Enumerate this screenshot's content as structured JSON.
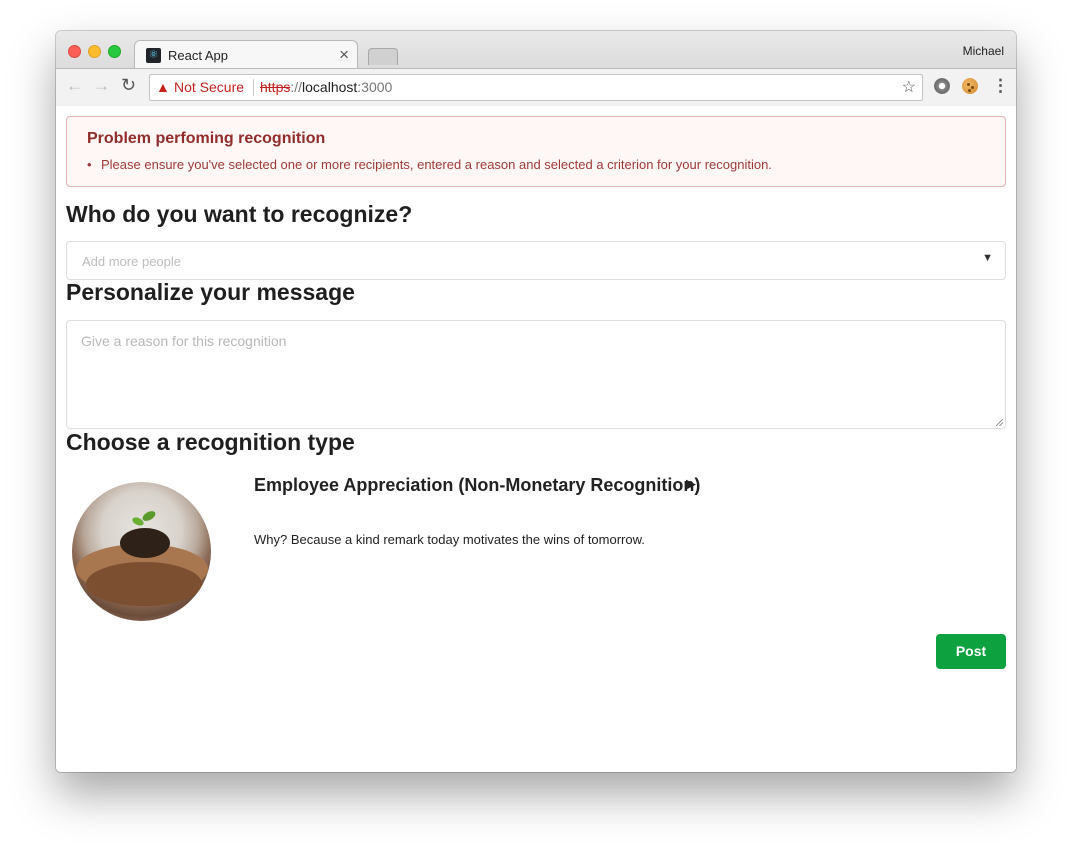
{
  "browser": {
    "tab_title": "React App",
    "tab_close": "×",
    "profile_name": "Michael",
    "security_label": "Not Secure",
    "url_scheme": "https",
    "url_separator": "://",
    "url_host": "localhost",
    "url_port": ":3000"
  },
  "alert": {
    "title": "Problem perfoming recognition",
    "items": [
      "Please ensure you've selected one or more recipients, entered a reason and selected a criterion for your recognition."
    ]
  },
  "recipients": {
    "heading": "Who do you want to recognize?",
    "placeholder": "Add more people"
  },
  "message": {
    "heading": "Personalize your message",
    "placeholder": "Give a reason for this recognition"
  },
  "recognition_type": {
    "heading": "Choose a recognition type",
    "title": "Employee Appreciation (Non-Monetary Recognition)",
    "description": "Why? Because a kind remark today motivates the wins of tomorrow."
  },
  "actions": {
    "post_label": "Post"
  },
  "colors": {
    "alert_title": "#912d2b",
    "alert_text": "#9f3a38",
    "post_button": "#0da13f",
    "not_secure": "#c5221f"
  }
}
